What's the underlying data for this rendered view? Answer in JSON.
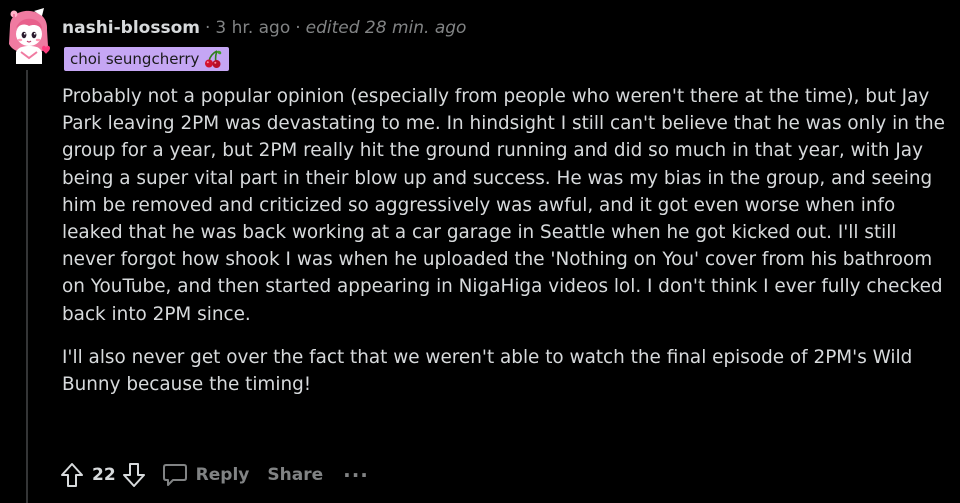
{
  "comment": {
    "author": "nashi-blossom",
    "separator": "·",
    "time": "3 hr. ago",
    "edited": "edited 28 min. ago",
    "flair": "choi seungcherry",
    "flair_color": "#c5a6f4",
    "paragraphs": [
      "Probably not a popular opinion (especially from people who weren't there at the time), but Jay Park leaving 2PM was devastating to me. In hindsight I still can't believe that he was only in the group for a year, but 2PM really hit the ground running and did so much in that year, with Jay being a super vital part in their blow up and success. He was my bias in the group, and seeing him be removed and criticized so aggressively was awful, and it got even worse when info leaked that he was back working at a car garage in Seattle when he got kicked out. I'll still never forgot how shook I was when he uploaded the 'Nothing on You' cover from his bathroom on YouTube, and then started appearing in NigaHiga videos lol. I don't think I ever fully checked back into 2PM since.",
      "I'll also never get over the fact that we weren't able to watch the final episode of 2PM's Wild Bunny because the timing!"
    ]
  },
  "actions": {
    "upvote_icon": "arrow-up-icon",
    "score": "22",
    "downvote_icon": "arrow-down-icon",
    "reply_icon": "speech-bubble-icon",
    "reply_label": "Reply",
    "share_label": "Share",
    "more_label": "···"
  },
  "colors": {
    "background": "#000000",
    "text": "#d7dadc",
    "muted": "#818384",
    "thread_line": "#343536"
  }
}
